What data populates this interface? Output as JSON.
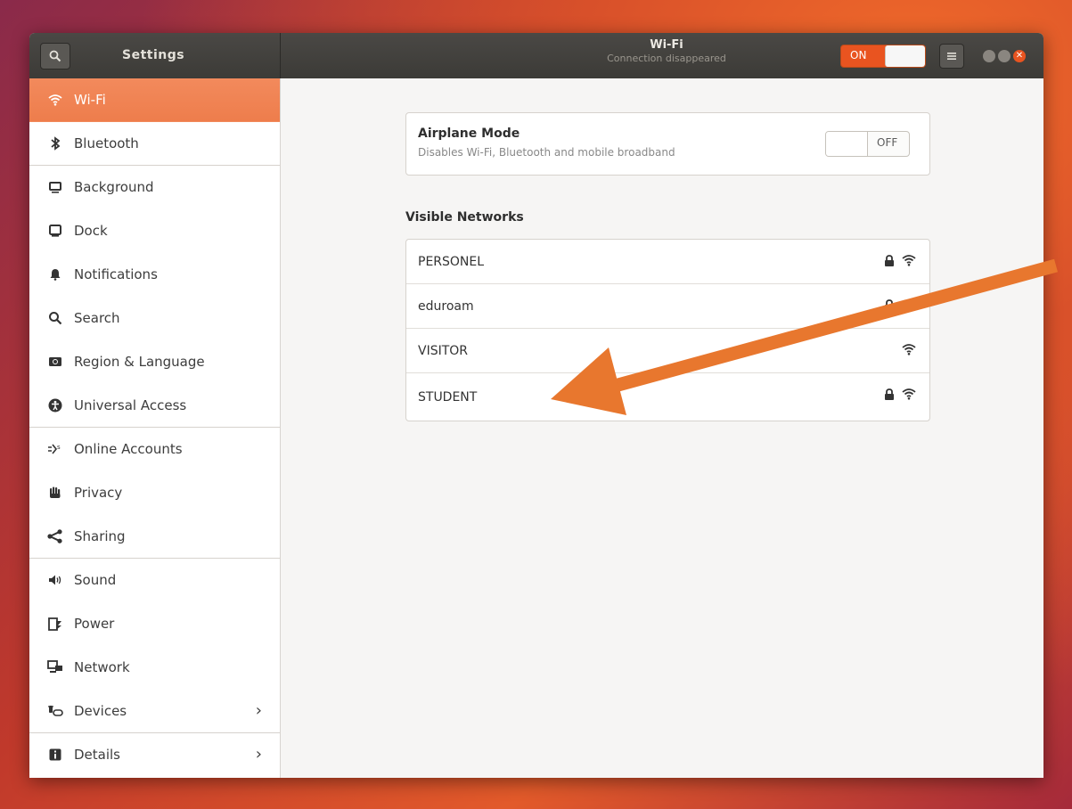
{
  "header": {
    "left_title": "Settings",
    "title": "Wi-Fi",
    "subtitle": "Connection disappeared",
    "wifi_switch_label": "ON"
  },
  "sidebar": {
    "items": [
      {
        "label": "Wi-Fi",
        "icon": "wifi-icon"
      },
      {
        "label": "Bluetooth",
        "icon": "bluetooth-icon"
      },
      {
        "label": "Background",
        "icon": "background-icon"
      },
      {
        "label": "Dock",
        "icon": "dock-icon"
      },
      {
        "label": "Notifications",
        "icon": "bell-icon"
      },
      {
        "label": "Search",
        "icon": "search-icon"
      },
      {
        "label": "Region & Language",
        "icon": "region-icon"
      },
      {
        "label": "Universal Access",
        "icon": "universal-access-icon"
      },
      {
        "label": "Online Accounts",
        "icon": "online-accounts-icon"
      },
      {
        "label": "Privacy",
        "icon": "hand-icon"
      },
      {
        "label": "Sharing",
        "icon": "share-icon"
      },
      {
        "label": "Sound",
        "icon": "speaker-icon"
      },
      {
        "label": "Power",
        "icon": "power-icon"
      },
      {
        "label": "Network",
        "icon": "network-icon"
      },
      {
        "label": "Devices",
        "icon": "devices-icon"
      },
      {
        "label": "Details",
        "icon": "info-icon"
      }
    ]
  },
  "airplane": {
    "title": "Airplane Mode",
    "subtitle": "Disables Wi-Fi, Bluetooth and mobile broadband",
    "switch_label": "OFF"
  },
  "networks": {
    "heading": "Visible Networks",
    "items": [
      {
        "name": "PERSONEL",
        "secured": true
      },
      {
        "name": "eduroam",
        "secured": true
      },
      {
        "name": "VISITOR",
        "secured": false
      },
      {
        "name": "STUDENT",
        "secured": true
      }
    ]
  },
  "colors": {
    "accent": "#e95420",
    "annotation_arrow": "#e8772e"
  }
}
